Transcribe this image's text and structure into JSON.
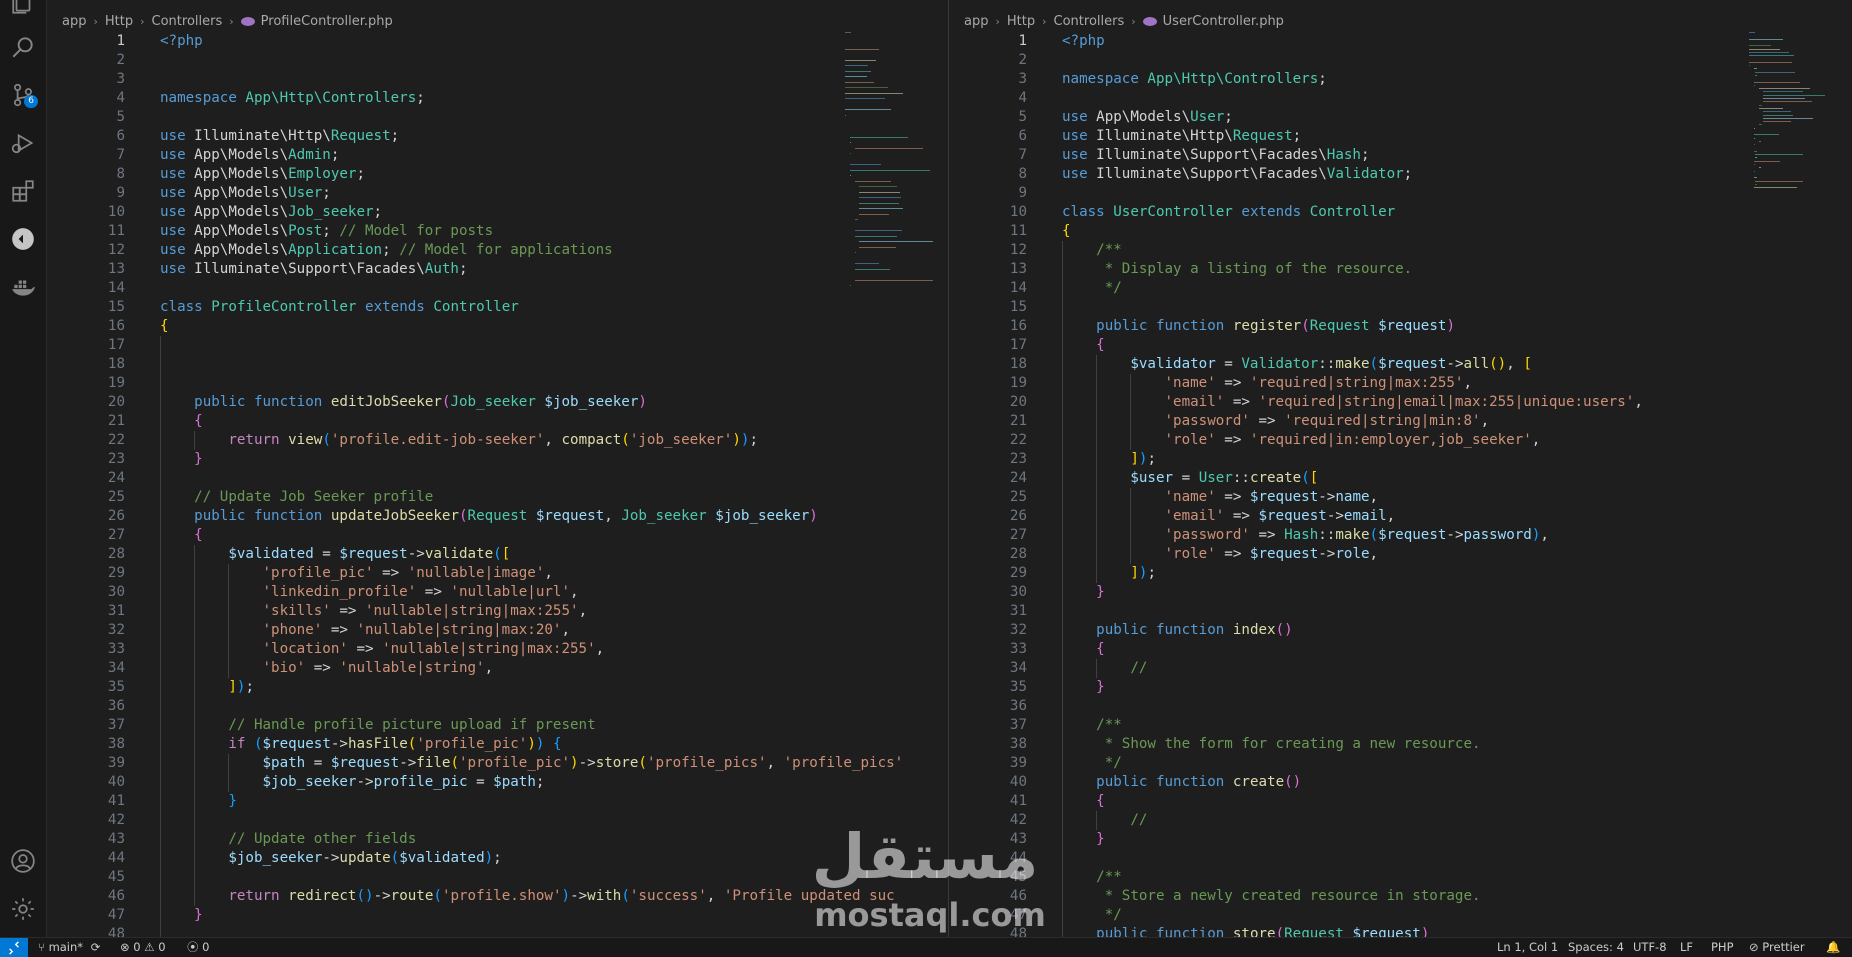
{
  "activity_bar": {
    "items": [
      {
        "icon": "explorer-icon"
      },
      {
        "icon": "search-icon"
      },
      {
        "icon": "source-control-icon",
        "badge": "6"
      },
      {
        "icon": "run-debug-icon"
      },
      {
        "icon": "extensions-icon"
      },
      {
        "icon": "remote-icon"
      },
      {
        "icon": "docker-icon"
      }
    ],
    "bottom": [
      {
        "icon": "account-icon"
      },
      {
        "icon": "settings-gear-icon"
      }
    ]
  },
  "left_editor": {
    "breadcrumb": [
      "app",
      "Http",
      "Controllers",
      "ProfileController.php"
    ],
    "active_line": 1,
    "lines": [
      {
        "n": 1,
        "h": "<span class='k'>&lt;?php</span>"
      },
      {
        "n": 2,
        "h": ""
      },
      {
        "n": 3,
        "h": ""
      },
      {
        "n": 4,
        "h": "<span class='k'>namespace</span> <span class='t'>App\\Http\\Controllers</span>;"
      },
      {
        "n": 5,
        "h": ""
      },
      {
        "n": 6,
        "h": "<span class='k'>use</span> Illuminate\\Http\\<span class='t'>Request</span>;"
      },
      {
        "n": 7,
        "h": "<span class='k'>use</span> App\\Models\\<span class='t'>Admin</span>;"
      },
      {
        "n": 8,
        "h": "<span class='k'>use</span> App\\Models\\<span class='t'>Employer</span>;"
      },
      {
        "n": 9,
        "h": "<span class='k'>use</span> App\\Models\\<span class='t'>User</span>;"
      },
      {
        "n": 10,
        "h": "<span class='k'>use</span> App\\Models\\<span class='t'>Job_seeker</span>;"
      },
      {
        "n": 11,
        "h": "<span class='k'>use</span> App\\Models\\<span class='t'>Post</span>; <span class='c'>// Model for posts</span>"
      },
      {
        "n": 12,
        "h": "<span class='k'>use</span> App\\Models\\<span class='t'>Application</span>; <span class='c'>// Model for applications</span>"
      },
      {
        "n": 13,
        "h": "<span class='k'>use</span> Illuminate\\Support\\Facades\\<span class='t'>Auth</span>;"
      },
      {
        "n": 14,
        "h": ""
      },
      {
        "n": 15,
        "h": "<span class='k'>class</span> <span class='t'>ProfileController</span> <span class='k'>extends</span> <span class='t'>Controller</span>"
      },
      {
        "n": 16,
        "h": "<span class='p'>{</span>"
      },
      {
        "n": 17,
        "h": ""
      },
      {
        "n": 18,
        "h": ""
      },
      {
        "n": 19,
        "h": ""
      },
      {
        "n": 20,
        "h": "    <span class='k'>public</span> <span class='k'>function</span> <span class='f'>editJobSeeker</span><span class='p2'>(</span><span class='t'>Job_seeker</span> <span class='v'>$job_seeker</span><span class='p2'>)</span>"
      },
      {
        "n": 21,
        "h": "    <span class='p2'>{</span>"
      },
      {
        "n": 22,
        "h": "        <span class='ctl'>return</span> <span class='f'>view</span><span class='p3'>(</span><span class='s'>'profile.edit-job-seeker'</span>, <span class='f'>compact</span><span class='p'>(</span><span class='s'>'job_seeker'</span><span class='p'>)</span><span class='p3'>)</span>;"
      },
      {
        "n": 23,
        "h": "    <span class='p2'>}</span>"
      },
      {
        "n": 24,
        "h": ""
      },
      {
        "n": 25,
        "h": "    <span class='c'>// Update Job Seeker profile</span>"
      },
      {
        "n": 26,
        "h": "    <span class='k'>public</span> <span class='k'>function</span> <span class='f'>updateJobSeeker</span><span class='p2'>(</span><span class='t'>Request</span> <span class='v'>$request</span>, <span class='t'>Job_seeker</span> <span class='v'>$job_seeker</span><span class='p2'>)</span>"
      },
      {
        "n": 27,
        "h": "    <span class='p2'>{</span>"
      },
      {
        "n": 28,
        "h": "        <span class='v'>$validated</span> = <span class='v'>$request</span>-&gt;<span class='f'>validate</span><span class='p3'>(</span><span class='p'>[</span>"
      },
      {
        "n": 29,
        "h": "            <span class='s'>'profile_pic'</span> =&gt; <span class='s'>'nullable|image'</span>,"
      },
      {
        "n": 30,
        "h": "            <span class='s'>'linkedin_profile'</span> =&gt; <span class='s'>'nullable|url'</span>,"
      },
      {
        "n": 31,
        "h": "            <span class='s'>'skills'</span> =&gt; <span class='s'>'nullable|string|max:255'</span>,"
      },
      {
        "n": 32,
        "h": "            <span class='s'>'phone'</span> =&gt; <span class='s'>'nullable|string|max:20'</span>,"
      },
      {
        "n": 33,
        "h": "            <span class='s'>'location'</span> =&gt; <span class='s'>'nullable|string|max:255'</span>,"
      },
      {
        "n": 34,
        "h": "            <span class='s'>'bio'</span> =&gt; <span class='s'>'nullable|string'</span>,"
      },
      {
        "n": 35,
        "h": "        <span class='p'>]</span><span class='p3'>)</span>;"
      },
      {
        "n": 36,
        "h": ""
      },
      {
        "n": 37,
        "h": "        <span class='c'>// Handle profile picture upload if present</span>"
      },
      {
        "n": 38,
        "h": "        <span class='ctl'>if</span> <span class='p3'>(</span><span class='v'>$request</span>-&gt;<span class='f'>hasFile</span><span class='p'>(</span><span class='s'>'profile_pic'</span><span class='p'>)</span><span class='p3'>)</span> <span class='p3'>{</span>"
      },
      {
        "n": 39,
        "h": "            <span class='v'>$path</span> = <span class='v'>$request</span>-&gt;<span class='f'>file</span><span class='p'>(</span><span class='s'>'profile_pic'</span><span class='p'>)</span>-&gt;<span class='f'>store</span><span class='p'>(</span><span class='s'>'profile_pics'</span>, <span class='s'>'profile_pics'</span>"
      },
      {
        "n": 40,
        "h": "            <span class='v'>$job_seeker</span>-&gt;<span class='v'>profile_pic</span> = <span class='v'>$path</span>;"
      },
      {
        "n": 41,
        "h": "        <span class='p3'>}</span>"
      },
      {
        "n": 42,
        "h": ""
      },
      {
        "n": 43,
        "h": "        <span class='c'>// Update other fields</span>"
      },
      {
        "n": 44,
        "h": "        <span class='v'>$job_seeker</span>-&gt;<span class='f'>update</span><span class='p3'>(</span><span class='v'>$validated</span><span class='p3'>)</span>;"
      },
      {
        "n": 45,
        "h": ""
      },
      {
        "n": 46,
        "h": "        <span class='ctl'>return</span> <span class='f'>redirect</span><span class='p3'>()</span>-&gt;<span class='f'>route</span><span class='p3'>(</span><span class='s'>'profile.show'</span><span class='p3'>)</span>-&gt;<span class='f'>with</span><span class='p3'>(</span><span class='s'>'success'</span>, <span class='s'>'Profile updated suc</span>"
      },
      {
        "n": 47,
        "h": "    <span class='p2'>}</span>"
      },
      {
        "n": 48,
        "h": ""
      }
    ]
  },
  "right_editor": {
    "breadcrumb": [
      "app",
      "Http",
      "Controllers",
      "UserController.php"
    ],
    "active_line": 1,
    "lines": [
      {
        "n": 1,
        "h": "<span class='k'>&lt;?php</span>"
      },
      {
        "n": 2,
        "h": ""
      },
      {
        "n": 3,
        "h": "<span class='k'>namespace</span> <span class='t'>App\\Http\\Controllers</span>;"
      },
      {
        "n": 4,
        "h": ""
      },
      {
        "n": 5,
        "h": "<span class='k'>use</span> App\\Models\\<span class='t'>User</span>;"
      },
      {
        "n": 6,
        "h": "<span class='k'>use</span> Illuminate\\Http\\<span class='t'>Request</span>;"
      },
      {
        "n": 7,
        "h": "<span class='k'>use</span> Illuminate\\Support\\Facades\\<span class='t'>Hash</span>;"
      },
      {
        "n": 8,
        "h": "<span class='k'>use</span> Illuminate\\Support\\Facades\\<span class='t'>Validator</span>;"
      },
      {
        "n": 9,
        "h": ""
      },
      {
        "n": 10,
        "h": "<span class='k'>class</span> <span class='t'>UserController</span> <span class='k'>extends</span> <span class='t'>Controller</span>"
      },
      {
        "n": 11,
        "h": "<span class='p'>{</span>"
      },
      {
        "n": 12,
        "h": "    <span class='c'>/**</span>"
      },
      {
        "n": 13,
        "h": "<span class='c'>     * Display a listing of the resource.</span>"
      },
      {
        "n": 14,
        "h": "<span class='c'>     */</span>"
      },
      {
        "n": 15,
        "h": ""
      },
      {
        "n": 16,
        "h": "    <span class='k'>public</span> <span class='k'>function</span> <span class='f'>register</span><span class='p2'>(</span><span class='t'>Request</span> <span class='v'>$request</span><span class='p2'>)</span>"
      },
      {
        "n": 17,
        "h": "    <span class='p2'>{</span>"
      },
      {
        "n": 18,
        "h": "        <span class='v'>$validator</span> = <span class='t'>Validator</span>::<span class='f'>make</span><span class='p3'>(</span><span class='v'>$request</span>-&gt;<span class='f'>all</span><span class='p'>()</span>, <span class='p'>[</span>"
      },
      {
        "n": 19,
        "h": "            <span class='s'>'name'</span> =&gt; <span class='s'>'required|string|max:255'</span>,"
      },
      {
        "n": 20,
        "h": "            <span class='s'>'email'</span> =&gt; <span class='s'>'required|string|email|max:255|unique:users'</span>,"
      },
      {
        "n": 21,
        "h": "            <span class='s'>'password'</span> =&gt; <span class='s'>'required|string|min:8'</span>,"
      },
      {
        "n": 22,
        "h": "            <span class='s'>'role'</span> =&gt; <span class='s'>'required|in:employer,job_seeker'</span>,"
      },
      {
        "n": 23,
        "h": "        <span class='p'>]</span><span class='p3'>)</span>;"
      },
      {
        "n": 24,
        "h": "        <span class='v'>$user</span> = <span class='t'>User</span>::<span class='f'>create</span><span class='p3'>(</span><span class='p'>[</span>"
      },
      {
        "n": 25,
        "h": "            <span class='s'>'name'</span> =&gt; <span class='v'>$request</span>-&gt;<span class='v'>name</span>,"
      },
      {
        "n": 26,
        "h": "            <span class='s'>'email'</span> =&gt; <span class='v'>$request</span>-&gt;<span class='v'>email</span>,"
      },
      {
        "n": 27,
        "h": "            <span class='s'>'password'</span> =&gt; <span class='t'>Hash</span>::<span class='f'>make</span><span class='p3'>(</span><span class='v'>$request</span>-&gt;<span class='v'>password</span><span class='p3'>)</span>,"
      },
      {
        "n": 28,
        "h": "            <span class='s'>'role'</span> =&gt; <span class='v'>$request</span>-&gt;<span class='v'>role</span>,"
      },
      {
        "n": 29,
        "h": "        <span class='p'>]</span><span class='p3'>)</span>;"
      },
      {
        "n": 30,
        "h": "    <span class='p2'>}</span>"
      },
      {
        "n": 31,
        "h": ""
      },
      {
        "n": 32,
        "h": "    <span class='k'>public</span> <span class='k'>function</span> <span class='f'>index</span><span class='p2'>()</span>"
      },
      {
        "n": 33,
        "h": "    <span class='p2'>{</span>"
      },
      {
        "n": 34,
        "h": "        <span class='c'>//</span>"
      },
      {
        "n": 35,
        "h": "    <span class='p2'>}</span>"
      },
      {
        "n": 36,
        "h": ""
      },
      {
        "n": 37,
        "h": "    <span class='c'>/**</span>"
      },
      {
        "n": 38,
        "h": "<span class='c'>     * Show the form for creating a new resource.</span>"
      },
      {
        "n": 39,
        "h": "<span class='c'>     */</span>"
      },
      {
        "n": 40,
        "h": "    <span class='k'>public</span> <span class='k'>function</span> <span class='f'>create</span><span class='p2'>()</span>"
      },
      {
        "n": 41,
        "h": "    <span class='p2'>{</span>"
      },
      {
        "n": 42,
        "h": "        <span class='c'>//</span>"
      },
      {
        "n": 43,
        "h": "    <span class='p2'>}</span>"
      },
      {
        "n": 44,
        "h": ""
      },
      {
        "n": 45,
        "h": "    <span class='c'>/**</span>"
      },
      {
        "n": 46,
        "h": "<span class='c'>     * Store a newly created resource in storage.</span>"
      },
      {
        "n": 47,
        "h": "<span class='c'>     */</span>"
      },
      {
        "n": 48,
        "h": "    <span class='k'>public</span> <span class='k'>function</span> <span class='f'>store</span><span class='p2'>(</span><span class='t'>Request</span> <span class='v'>$request</span><span class='p2'>)</span>"
      }
    ]
  },
  "statusbar": {
    "branch": "main*",
    "errors": "0",
    "warnings": "0",
    "ports": "0",
    "cursor": "Ln 1, Col 1",
    "spaces": "Spaces: 4",
    "encoding": "UTF-8",
    "eol": "LF",
    "language": "PHP",
    "formatter": "Prettier"
  },
  "watermark": {
    "arabic": "مستقل",
    "latin": "mostaql.com"
  },
  "colors": {
    "accent": "#0078d4",
    "background": "#1e1e1e",
    "activity_bar": "#181818"
  }
}
